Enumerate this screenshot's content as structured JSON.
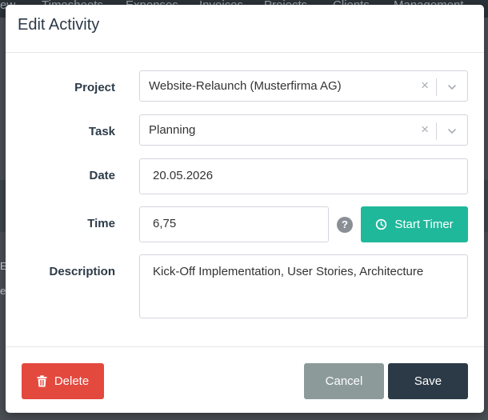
{
  "background": {
    "nav_items": [
      "ew",
      "Timesheets",
      "Expenses",
      "Invoices",
      "Projects",
      "Clients",
      "Management"
    ],
    "left_fragments": [
      "E",
      "e"
    ]
  },
  "modal": {
    "title": "Edit Activity",
    "fields": {
      "project": {
        "label": "Project",
        "value": "Website-Relaunch (Musterfirma AG)",
        "clear": "×"
      },
      "task": {
        "label": "Task",
        "value": "Planning",
        "clear": "×"
      },
      "date": {
        "label": "Date",
        "value": "20.05.2026"
      },
      "time": {
        "label": "Time",
        "value": "6,75",
        "help": "?"
      },
      "description": {
        "label": "Description",
        "value": "Kick-Off Implementation, User Stories, Architecture"
      }
    },
    "buttons": {
      "start_timer": "Start Timer",
      "delete": "Delete",
      "cancel": "Cancel",
      "save": "Save"
    }
  },
  "colors": {
    "timer": "#1fb89b",
    "delete": "#e4493e",
    "cancel": "#8c9a9a",
    "save": "#2c3a47"
  },
  "icons": {
    "timer": "clock-icon",
    "delete": "trash-icon",
    "select": "chevron-down-icon",
    "help": "help-icon"
  }
}
